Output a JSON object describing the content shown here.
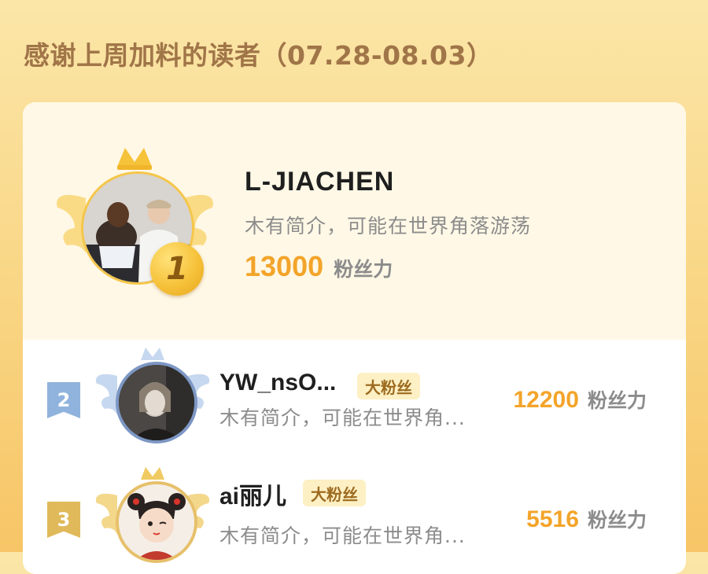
{
  "header": {
    "title": "感谢上周加料的读者（07.28-08.03）"
  },
  "top": {
    "rank": "1",
    "name": "L-JIACHEN",
    "bio": "木有简介，可能在世界角落游荡",
    "score": "13000",
    "score_unit": "粉丝力"
  },
  "rows": [
    {
      "rank": "2",
      "name": "YW_nsO...",
      "badge": "大粉丝",
      "bio": "木有简介，可能在世界角...",
      "score": "12200",
      "score_unit": "粉丝力",
      "rank_color": "#8fb3dc"
    },
    {
      "rank": "3",
      "name": "ai丽儿",
      "badge": "大粉丝",
      "bio": "木有简介，可能在世界角...",
      "score": "5516",
      "score_unit": "粉丝力",
      "rank_color": "#e0b95a"
    }
  ],
  "colors": {
    "accent_score": "#f3a42a",
    "title": "#a07548",
    "gold": "#f5c64a",
    "silver_blue": "#8fb3dc"
  },
  "icons": [
    "crown-icon",
    "wing-icon",
    "rank-1-medal-icon",
    "rank-2-ribbon-icon",
    "rank-3-ribbon-icon"
  ]
}
